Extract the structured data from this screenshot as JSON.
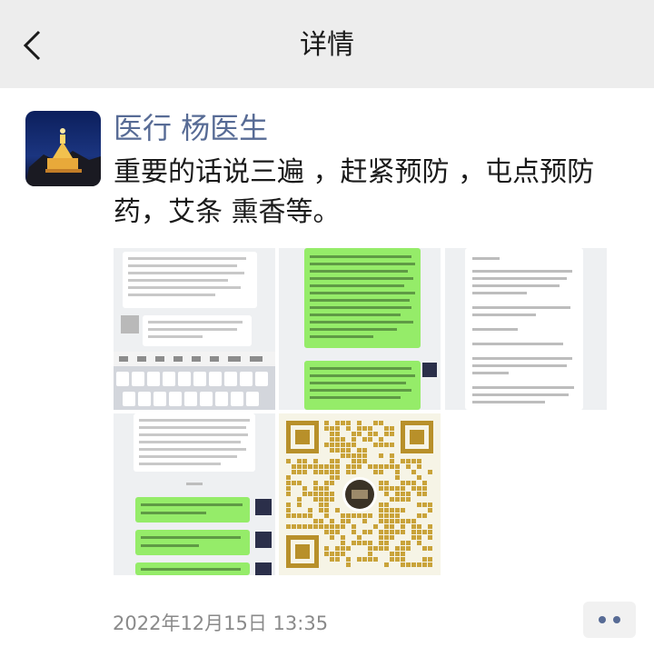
{
  "header": {
    "title": "详情",
    "back_icon": "chevron-left-icon"
  },
  "post": {
    "author": "医行 杨医生",
    "text": "重要的话说三遍 ，赶紧预防 ，屯点预防\n药，艾条 熏香等。",
    "timestamp": "2022年12月15日 13:35",
    "more_icon": "more-dots-icon",
    "image_count": 5
  },
  "colors": {
    "link": "#576b95",
    "header_bg": "#ededed",
    "timestamp": "#8a8a8a",
    "chat_green": "#95ec69"
  }
}
